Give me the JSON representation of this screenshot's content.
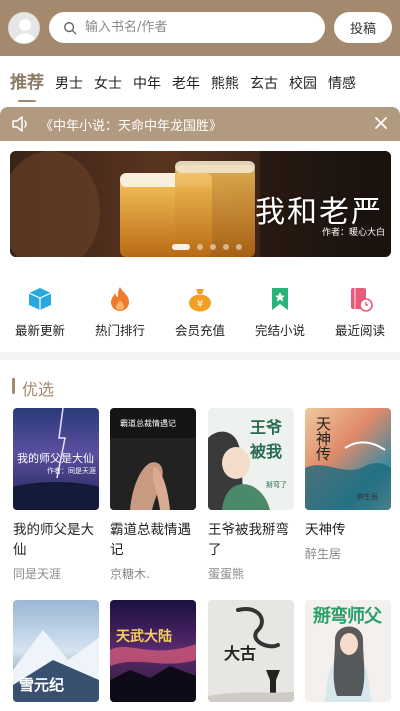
{
  "header": {
    "search_placeholder": "输入书名/作者",
    "submit_label": "投稿"
  },
  "tabs": [
    "推荐",
    "男士",
    "女士",
    "中年",
    "老年",
    "熊熊",
    "玄古",
    "校园",
    "情感"
  ],
  "notice": {
    "text": "《中年小说：天命中年龙国胜》"
  },
  "banner": {
    "title": "我和老严",
    "subtitle": "作者：暖心大白"
  },
  "quick_nav": [
    {
      "label": "最新更新",
      "icon": "box-icon",
      "color": "#29a8e0"
    },
    {
      "label": "热门排行",
      "icon": "fire-icon",
      "color": "#f07a2a"
    },
    {
      "label": "会员充值",
      "icon": "money-bag-icon",
      "color": "#f0a020"
    },
    {
      "label": "完结小说",
      "icon": "bookmark-icon",
      "color": "#2bb47a"
    },
    {
      "label": "最近阅读",
      "icon": "book-clock-icon",
      "color": "#e85a7a"
    }
  ],
  "section": {
    "title": "优选"
  },
  "books": [
    {
      "title": "我的师父是大仙",
      "author": "同是天涯",
      "cover_text": "我的师父是大仙",
      "cover_sub": "作者：同是天涯"
    },
    {
      "title": "霸道总裁情遇记",
      "author": "京糖木.",
      "cover_text": "霸道总裁情遇记"
    },
    {
      "title": "王爷被我掰弯了",
      "author": "蛋蛋熊",
      "cover_text": "王爷被我",
      "cover_sub": "掰弯了"
    },
    {
      "title": "天神传",
      "author": "醉生居",
      "cover_text": "天神传",
      "cover_sub": "醉生居"
    },
    {
      "title": "",
      "author": "",
      "cover_text": "雪元纪"
    },
    {
      "title": "",
      "author": "",
      "cover_text": "天武大陆"
    },
    {
      "title": "",
      "author": "",
      "cover_text": "大古"
    },
    {
      "title": "",
      "author": "",
      "cover_text": "掰弯师父"
    }
  ]
}
